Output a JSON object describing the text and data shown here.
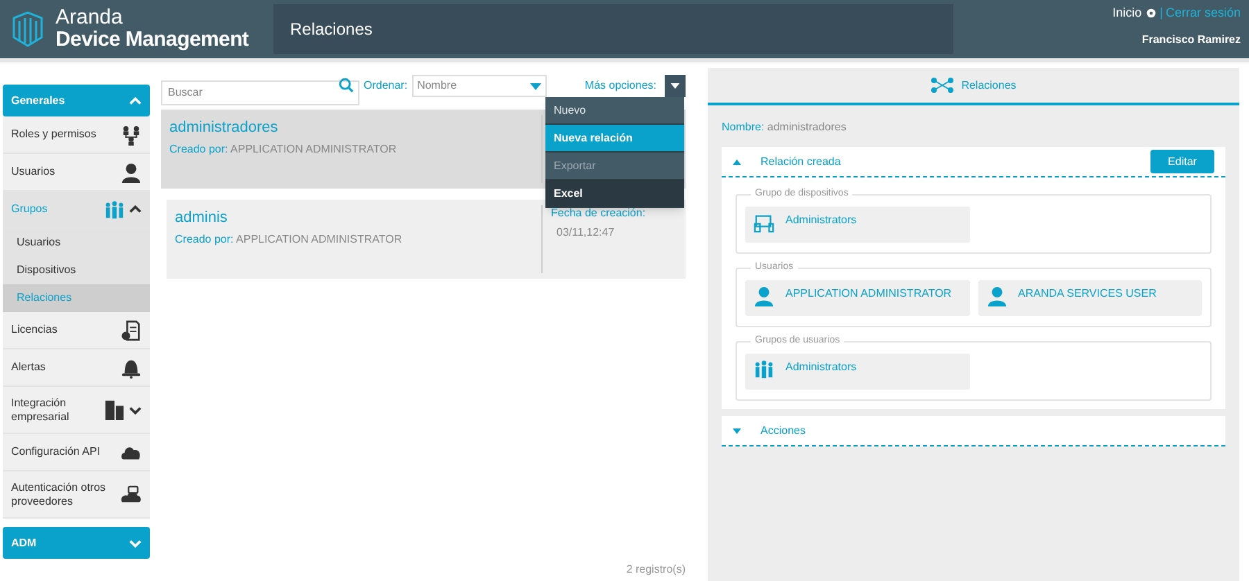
{
  "header": {
    "brand_top": "Aranda",
    "brand_bottom": "Device Management",
    "page_title": "Relaciones",
    "links": [
      {
        "label": "Inicio",
        "kind": "home"
      },
      {
        "label": "|",
        "kind": "separator"
      },
      {
        "label": "Cerrar sesión",
        "kind": "logout"
      }
    ],
    "user": "Francisco Ramirez"
  },
  "sidebar": {
    "sections": [
      {
        "label": "Generales",
        "expanded": true,
        "items": [
          {
            "label": "Roles y permisos",
            "kind": "roles",
            "selected": false
          },
          {
            "label": "Usuarios",
            "kind": "user",
            "selected": false
          },
          {
            "label": "Grupos",
            "kind": "group",
            "selected": true,
            "expanded": true,
            "children": [
              {
                "label": "Usuarios",
                "selected": false
              },
              {
                "label": "Dispositivos",
                "selected": false
              },
              {
                "label": "Relaciones",
                "selected": true
              }
            ]
          },
          {
            "label": "Licencias",
            "kind": "license",
            "selected": false
          },
          {
            "label": "Alertas",
            "kind": "bell",
            "selected": false
          },
          {
            "label": "Integración empresarial",
            "kind": "building",
            "selected": false,
            "expanded": false
          },
          {
            "label": "Configuración API",
            "kind": "cloud",
            "selected": false
          },
          {
            "label": "Autenticación otros proveedores",
            "kind": "auth",
            "selected": false
          }
        ]
      },
      {
        "label": "ADM",
        "expanded": false
      }
    ]
  },
  "list": {
    "search": {
      "placeholder": "Buscar"
    },
    "sort_label": "Ordenar:",
    "sort_value": "Nombre",
    "more_label": "Más opciones:",
    "menu": [
      {
        "label": "Nuevo",
        "kind": "item",
        "selected": false
      },
      {
        "label": "Nueva relación",
        "kind": "item",
        "selected": true
      },
      {
        "label": "Exportar",
        "kind": "section",
        "selected": false
      },
      {
        "label": "Excel",
        "kind": "subitem",
        "selected": false
      }
    ],
    "records": [
      {
        "title": "administradores",
        "created_label": "Creado por:",
        "created_by": "APPLICATION ADMINISTRATOR",
        "selected": true
      },
      {
        "title": "adminis",
        "created_label": "Creado por:",
        "created_by": "APPLICATION ADMINISTRATOR",
        "date_label": "Fecha de creación:",
        "date": "03/11,12:47",
        "selected": false
      }
    ],
    "footer": "2 registro(s)"
  },
  "detail": {
    "tab": "Relaciones",
    "name_label": "Nombre:",
    "name": "administradores",
    "sections": [
      {
        "title": "Relación creada",
        "expanded": true,
        "button": "Editar",
        "groups": [
          {
            "legend": "Grupo de dispositivos",
            "entries": [
              {
                "label": "Administrators",
                "kind": "devices"
              }
            ]
          },
          {
            "legend": "Usuarios",
            "entries": [
              {
                "label": "APPLICATION ADMINISTRATOR",
                "kind": "user"
              },
              {
                "label": "ARANDA SERVICES USER",
                "kind": "user"
              }
            ]
          },
          {
            "legend": "Grupos de usuarios",
            "entries": [
              {
                "label": "Administrators",
                "kind": "group"
              }
            ]
          }
        ]
      },
      {
        "title": "Acciones",
        "expanded": false
      }
    ]
  }
}
